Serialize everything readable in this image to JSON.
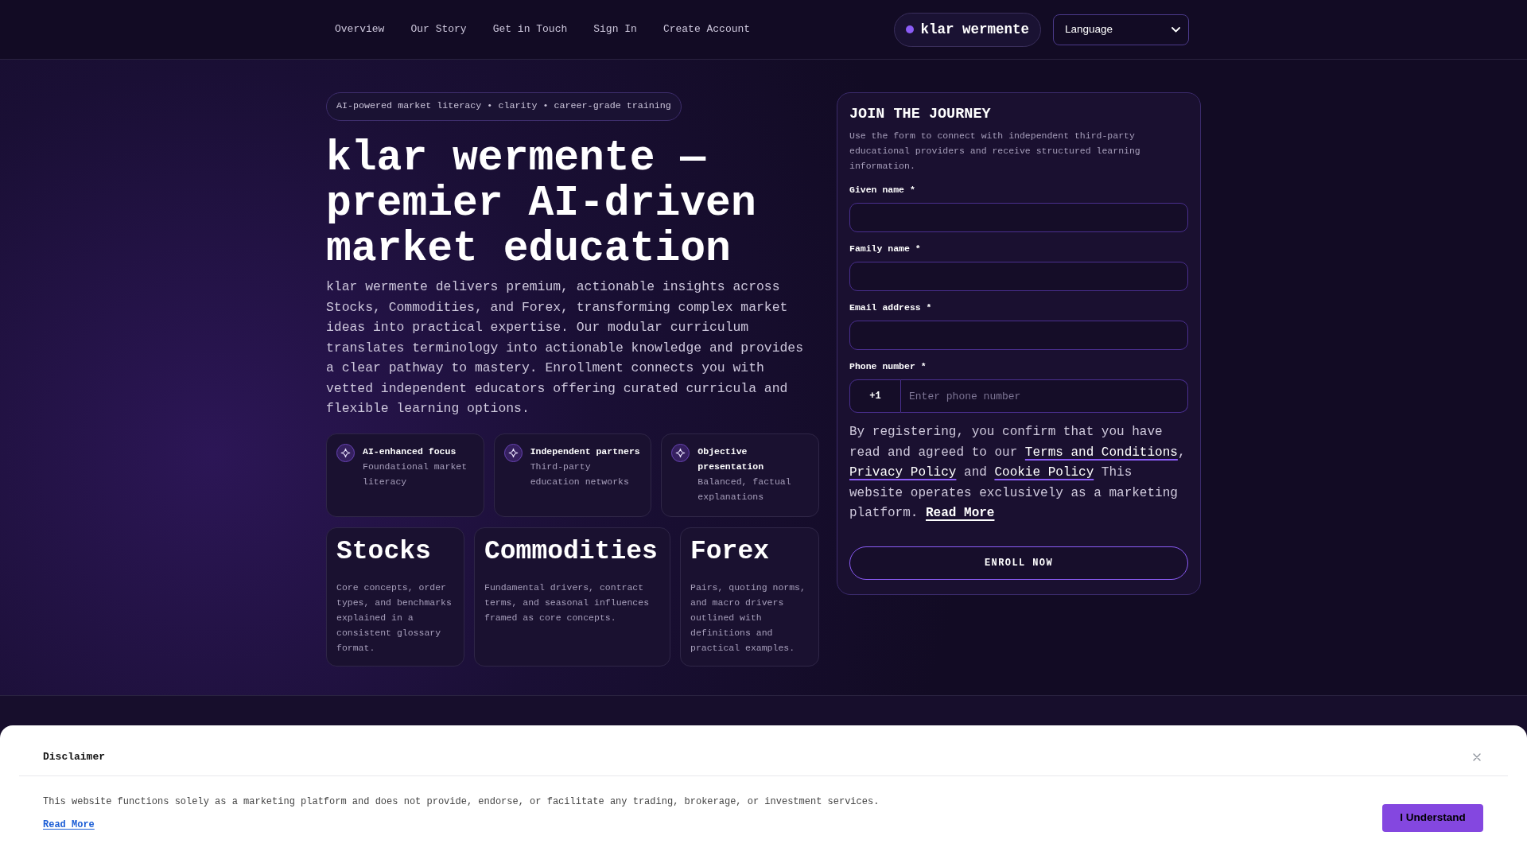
{
  "navigation": {
    "links": [
      "Overview",
      "Our Story",
      "Get in Touch",
      "Sign In",
      "Create Account"
    ],
    "brand": "klar wermente",
    "language_select": "Language"
  },
  "hero": {
    "badge": "AI-powered market literacy • clarity • career-grade training",
    "title": "klar wermente — premier AI-driven market education",
    "description": "klar wermente delivers premium, actionable insights across Stocks, Commodities, and Forex, transforming complex market ideas into practical expertise. Our modular curriculum translates terminology into actionable knowledge and provides a clear pathway to mastery. Enrollment connects you with vetted independent educators offering curated curricula and flexible learning options.",
    "features": [
      {
        "title": "AI-enhanced focus",
        "description": "Foundational market literacy"
      },
      {
        "title": "Independent partners",
        "description": "Third-party education networks"
      },
      {
        "title": "Objective presentation",
        "description": "Balanced, factual explanations"
      }
    ],
    "topics": [
      {
        "title": "Stocks",
        "description": "Core concepts, order types, and benchmarks explained in a consistent glossary format."
      },
      {
        "title": "Commodities",
        "description": "Fundamental drivers, contract terms, and seasonal influences framed as core concepts."
      },
      {
        "title": "Forex",
        "description": "Pairs, quoting norms, and macro drivers outlined with definitions and practical examples."
      }
    ]
  },
  "signup_form": {
    "title": "JOIN THE JOURNEY",
    "description": "Use the form to connect with independent third-party educational providers and receive structured learning information.",
    "fields": [
      {
        "kind": "text",
        "label": "Given name *"
      },
      {
        "kind": "text",
        "label": "Family name *"
      },
      {
        "kind": "text",
        "label": "Email address *"
      },
      {
        "kind": "phone",
        "label": "Phone number *",
        "prefix": "+1",
        "placeholder": "Enter phone number"
      }
    ],
    "consent": [
      {
        "kind": "text",
        "text": "By registering, you confirm that you have read and agreed to our "
      },
      {
        "kind": "link",
        "text": "Terms and Conditions"
      },
      {
        "kind": "text",
        "text": ", "
      },
      {
        "kind": "link",
        "text": "Privacy Policy"
      },
      {
        "kind": "text",
        "text": " and "
      },
      {
        "kind": "link",
        "text": "Cookie Policy"
      },
      {
        "kind": "text",
        "text": " This website operates exclusively as a marketing platform. "
      },
      {
        "kind": "strong_link",
        "text": "Read More"
      }
    ],
    "submit": "ENROLL NOW"
  },
  "disclaimer": {
    "title": "Disclaimer",
    "text": "This website functions solely as a marketing platform and does not provide, endorse, or facilitate any trading, brokerage, or investment services.",
    "link": "Read More",
    "button": "I Understand"
  }
}
